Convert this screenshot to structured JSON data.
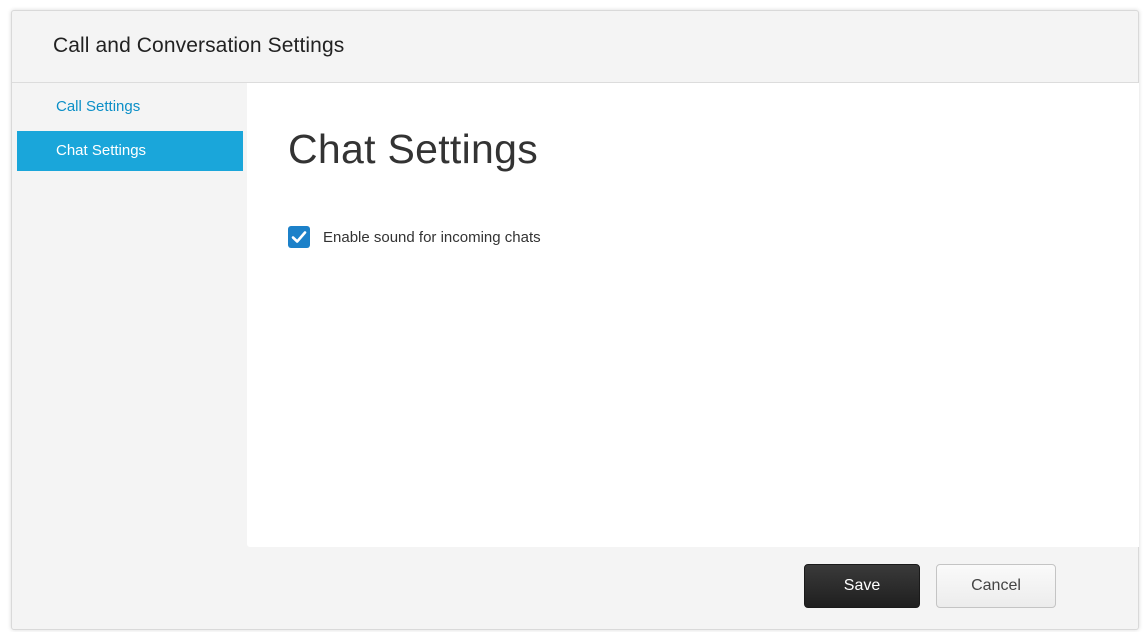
{
  "dialog": {
    "title": "Call and Conversation Settings"
  },
  "sidebar": {
    "items": [
      {
        "label": "Call Settings",
        "selected": false
      },
      {
        "label": "Chat Settings",
        "selected": true
      }
    ]
  },
  "content": {
    "title": "Chat Settings",
    "options": [
      {
        "label": "Enable sound for incoming chats",
        "checked": true,
        "icon": "checkmark-icon"
      }
    ]
  },
  "footer": {
    "save_label": "Save",
    "cancel_label": "Cancel"
  },
  "colors": {
    "accent": "#1aa6da",
    "link": "#0b8fc7",
    "checkbox": "#1c81c9",
    "primary_button": "#2b2b2b"
  }
}
